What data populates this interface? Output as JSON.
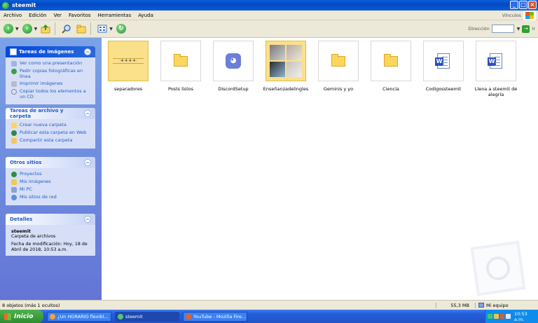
{
  "window": {
    "title": "steemit",
    "controls": [
      "minimize",
      "maximize",
      "close"
    ]
  },
  "menubar": {
    "items": [
      "Archivo",
      "Edición",
      "Ver",
      "Favoritos",
      "Herramientas",
      "Ayuda"
    ],
    "links_label": "Vínculos"
  },
  "toolbar": {
    "back_icon": "back-arrow-icon",
    "forward_icon": "forward-arrow-icon",
    "address_label": "Dirección",
    "go_label": "Ir"
  },
  "sidebar": {
    "image_tasks": {
      "title": "Tareas de imágenes",
      "items": [
        "Ver como una presentación",
        "Pedir copias fotográficas en línea",
        "Imprimir imágenes",
        "Copiar todos los elementos a un CD"
      ]
    },
    "file_tasks": {
      "title": "Tareas de archivo y carpeta",
      "items": [
        "Crear nueva carpeta",
        "Publicar esta carpeta en Web",
        "Compartir esta carpeta"
      ]
    },
    "other_places": {
      "title": "Otros sitios",
      "items": [
        "Proyectos",
        "Mis imágenes",
        "Mi PC",
        "Mis sitios de red"
      ]
    },
    "details": {
      "title": "Detalles",
      "name": "steemit",
      "type": "Carpeta de archivos",
      "modified": "Fecha de modificación: Hoy, 18 de Abril de 2018, 10:53 a.m."
    }
  },
  "files": [
    {
      "name": "separadores",
      "kind": "folder-thumbnail"
    },
    {
      "name": "Posts listos",
      "kind": "folder"
    },
    {
      "name": "DiscordSetup",
      "kind": "discord"
    },
    {
      "name": "Enseñanzadelingles",
      "kind": "photo-folder"
    },
    {
      "name": "Geminis y yo",
      "kind": "folder"
    },
    {
      "name": "Ciencia",
      "kind": "folder"
    },
    {
      "name": "Codigossteemit",
      "kind": "word"
    },
    {
      "name": "Llena a steemit de alegría",
      "kind": "word"
    }
  ],
  "statusbar": {
    "objects": "8 objetos (más 1 ocultos)",
    "size": "55,3 MB",
    "location": "Mi equipo"
  },
  "taskbar": {
    "start_label": "Inicio",
    "tasks": [
      "¿Un HORARIO flexibl...",
      "steemit",
      "YouTube - Mozilla Fire..."
    ],
    "clock": "10:53 a.m."
  },
  "colors": {
    "titlebar": "#0a5fd8",
    "sidebar": "#6f8fe0",
    "taskbar": "#245edb",
    "start": "#3a9d3a",
    "link": "#215dc6"
  }
}
